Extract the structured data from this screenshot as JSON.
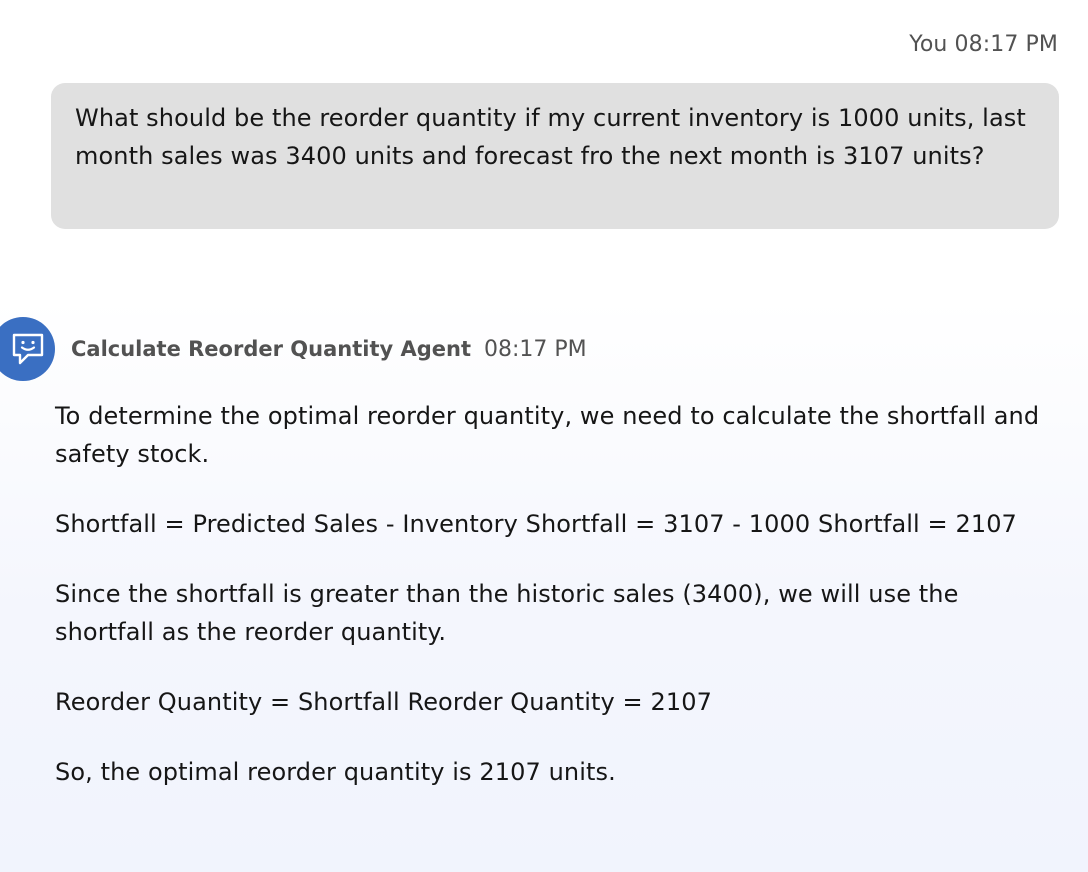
{
  "user_message": {
    "meta": "You 08:17 PM",
    "text": "What should be the reorder quantity if my current inventory is 1000 units, last month sales was 3400 units and forecast fro the next month is 3107 units?"
  },
  "agent_message": {
    "avatar_icon": "chat-bot-icon",
    "name": "Calculate Reorder Quantity Agent",
    "time": "08:17 PM",
    "paragraphs": [
      "To determine the optimal reorder quantity, we need to calculate the shortfall and safety stock.",
      "Shortfall = Predicted Sales - Inventory Shortfall = 3107 - 1000 Shortfall = 2107",
      "Since the shortfall is greater than the historic sales (3400), we will use the shortfall as the reorder quantity.",
      "Reorder Quantity = Shortfall Reorder Quantity = 2107",
      "So, the optimal reorder quantity is 2107 units."
    ]
  },
  "colors": {
    "user_bubble": "#e0e0e0",
    "avatar": "#3a6fc2",
    "meta_text": "#525252",
    "body_text": "#161616"
  }
}
